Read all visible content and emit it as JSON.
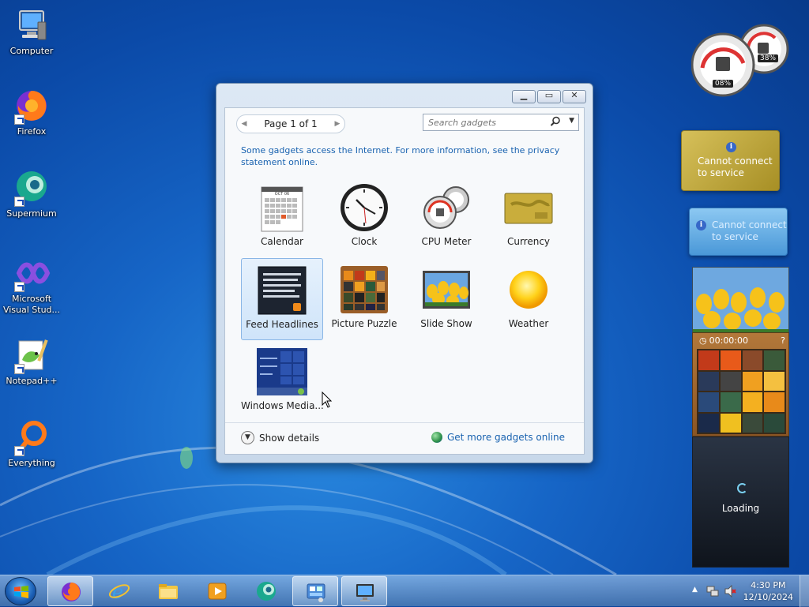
{
  "desktop": {
    "icons": [
      {
        "label": "Computer",
        "icon": "computer-icon"
      },
      {
        "label": "Firefox",
        "icon": "firefox-icon"
      },
      {
        "label": "Supermium",
        "icon": "supermium-icon"
      },
      {
        "label": "Microsoft Visual Stud...",
        "icon": "visual-studio-icon"
      },
      {
        "label": "Notepad++",
        "icon": "notepadpp-icon"
      },
      {
        "label": "Everything",
        "icon": "everything-icon"
      }
    ]
  },
  "gadget_window": {
    "pager": "Page 1 of 1",
    "search_placeholder": "Search gadgets",
    "notice": "Some gadgets access the Internet.  For more information, see the privacy statement online.",
    "gadgets": [
      {
        "name": "Calendar",
        "icon": "calendar-icon"
      },
      {
        "name": "Clock",
        "icon": "clock-icon"
      },
      {
        "name": "CPU Meter",
        "icon": "cpu-meter-icon"
      },
      {
        "name": "Currency",
        "icon": "currency-icon"
      },
      {
        "name": "Feed Headlines",
        "icon": "feed-headlines-icon",
        "selected": true
      },
      {
        "name": "Picture Puzzle",
        "icon": "picture-puzzle-icon"
      },
      {
        "name": "Slide Show",
        "icon": "slide-show-icon"
      },
      {
        "name": "Weather",
        "icon": "weather-icon"
      },
      {
        "name": "Windows Media...",
        "icon": "windows-media-icon"
      }
    ],
    "calendar_month": "OCT 06",
    "show_details": "Show details",
    "get_more": "Get more gadgets online"
  },
  "side_gadgets": {
    "cpu_percent": "08%",
    "memory_percent": "38%",
    "currency_message": "Cannot connect to service",
    "weather_message": "Cannot connect to service",
    "puzzle_timer": "00:00:00",
    "feed_loading": "Loading"
  },
  "taskbar": {
    "time": "4:30 PM",
    "date": "12/10/2024",
    "pinned": [
      "firefox-icon",
      "internet-explorer-icon",
      "file-explorer-icon",
      "media-player-icon",
      "supermium-icon",
      "gadgets-icon",
      "display-settings-icon"
    ]
  },
  "colors": {
    "accent": "#1a63b0",
    "currency_bg": "#c7ae3f",
    "weather_bg": "#5fa9e2"
  }
}
